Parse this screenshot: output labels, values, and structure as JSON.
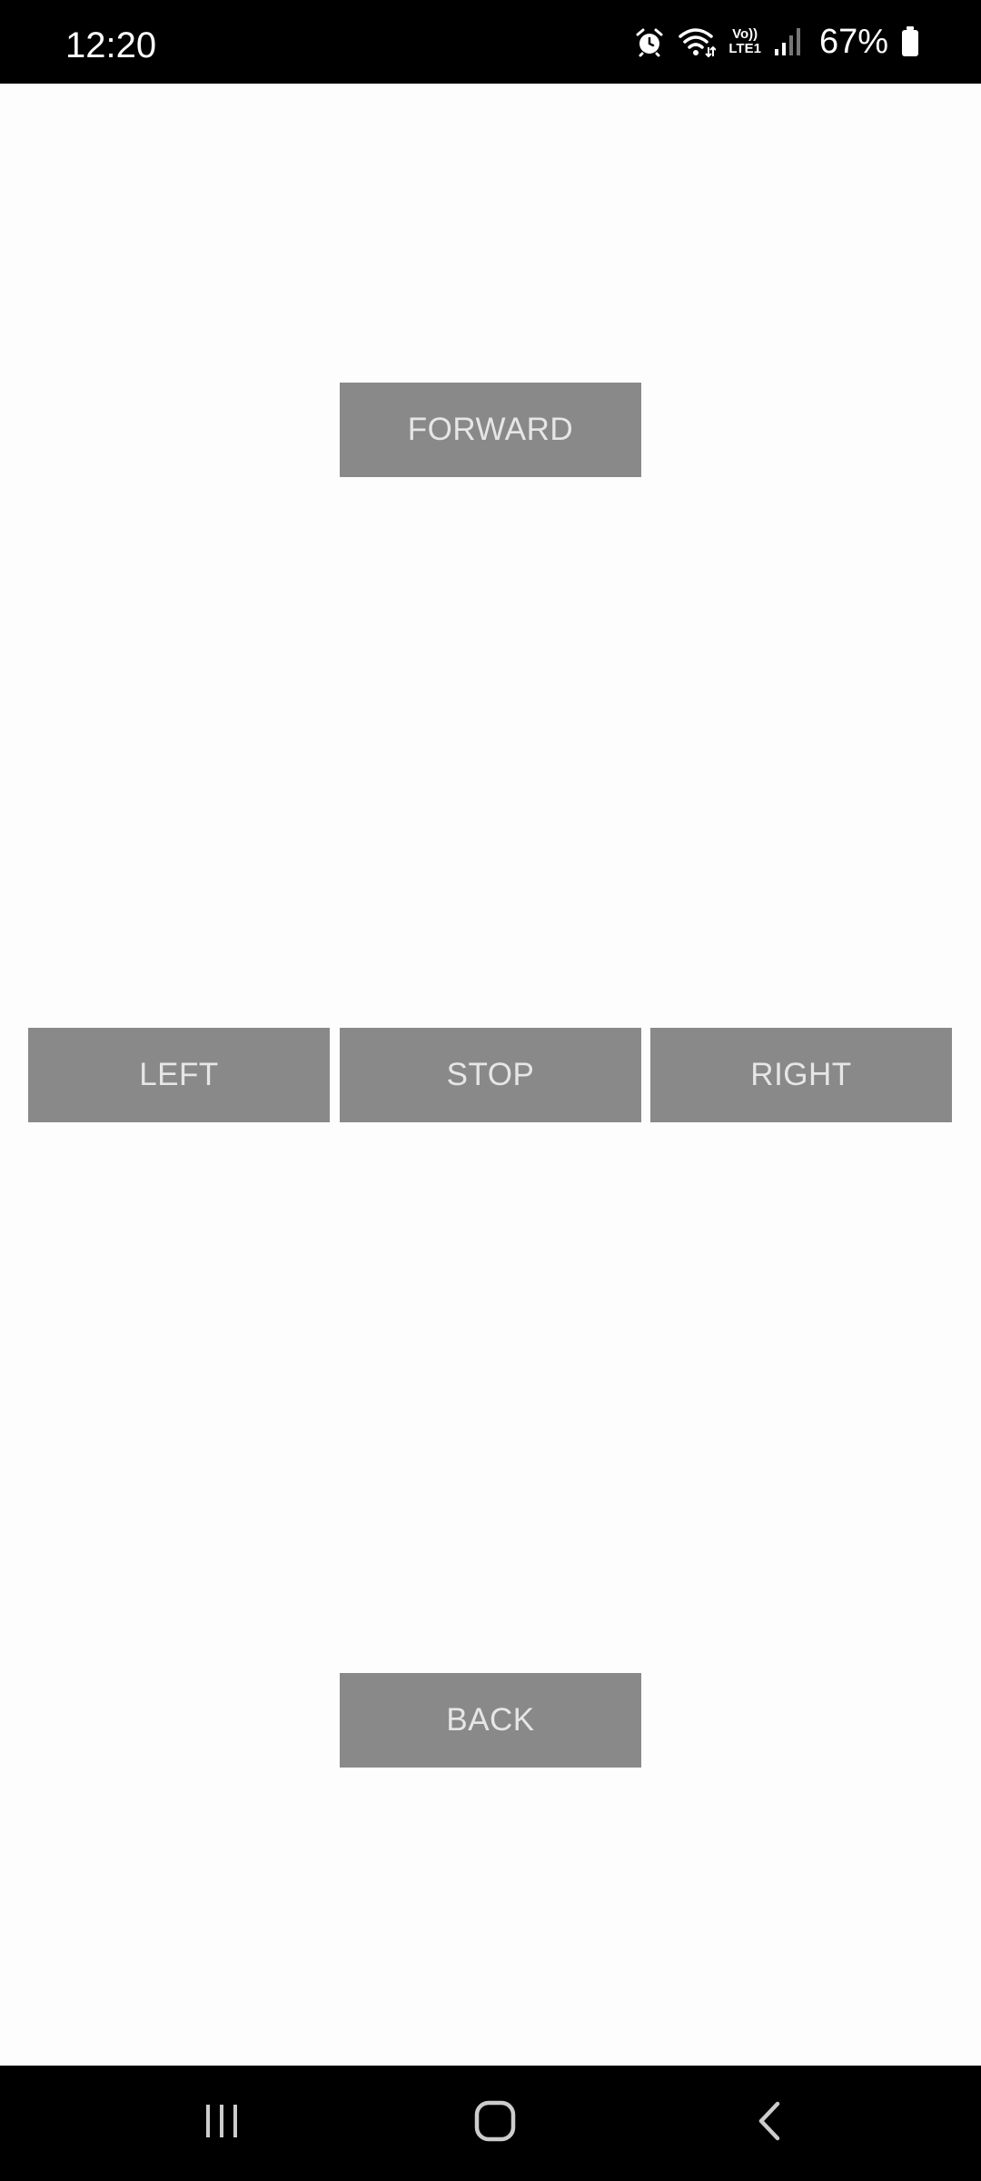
{
  "status_bar": {
    "time": "12:20",
    "network_top": "Vo))",
    "network_bottom": "LTE1",
    "battery_percent": "67%",
    "icons": [
      "alarm-icon",
      "wifi-icon",
      "signal-icon",
      "battery-icon"
    ]
  },
  "controls": {
    "forward_label": "FORWARD",
    "left_label": "LEFT",
    "stop_label": "STOP",
    "right_label": "RIGHT",
    "back_label": "BACK"
  },
  "nav_bar": {
    "icons": [
      "recents-icon",
      "home-icon",
      "back-icon"
    ]
  },
  "colors": {
    "button_background": "#898989",
    "button_text": "#e6e6e6",
    "screen_background": "#fdfdfd",
    "system_bar": "#000000"
  }
}
